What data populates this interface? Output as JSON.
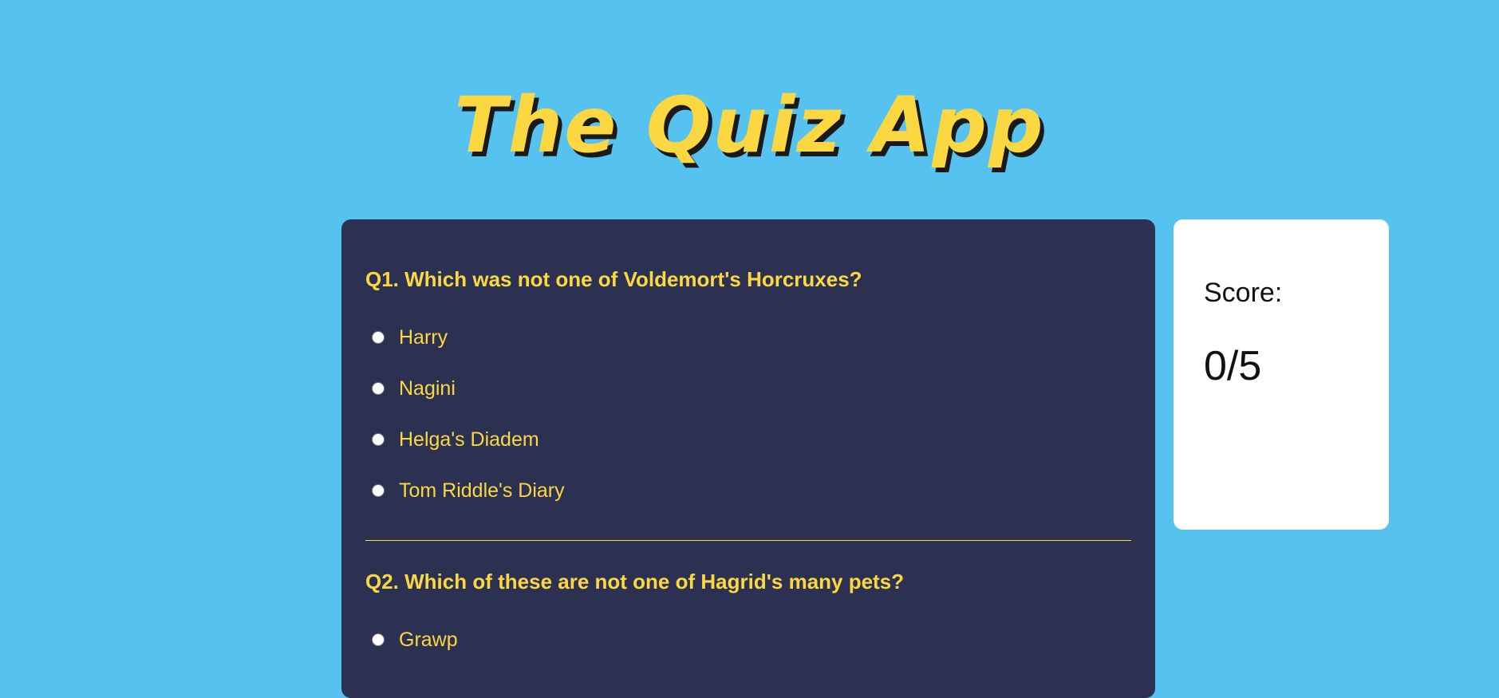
{
  "app": {
    "title": "The Quiz App"
  },
  "quiz": {
    "questions": [
      {
        "text": "Q1. Which was not one of Voldemort's Horcruxes?",
        "options": [
          "Harry",
          "Nagini",
          "Helga's Diadem",
          "Tom Riddle's Diary"
        ]
      },
      {
        "text": "Q2. Which of these are not one of Hagrid's many pets?",
        "options": [
          "Grawp"
        ]
      }
    ]
  },
  "score": {
    "label": "Score:",
    "value": "0/5"
  },
  "colors": {
    "background": "#55c2f0",
    "panel": "#2c3152",
    "accent": "#fbd842",
    "card": "#ffffff"
  }
}
